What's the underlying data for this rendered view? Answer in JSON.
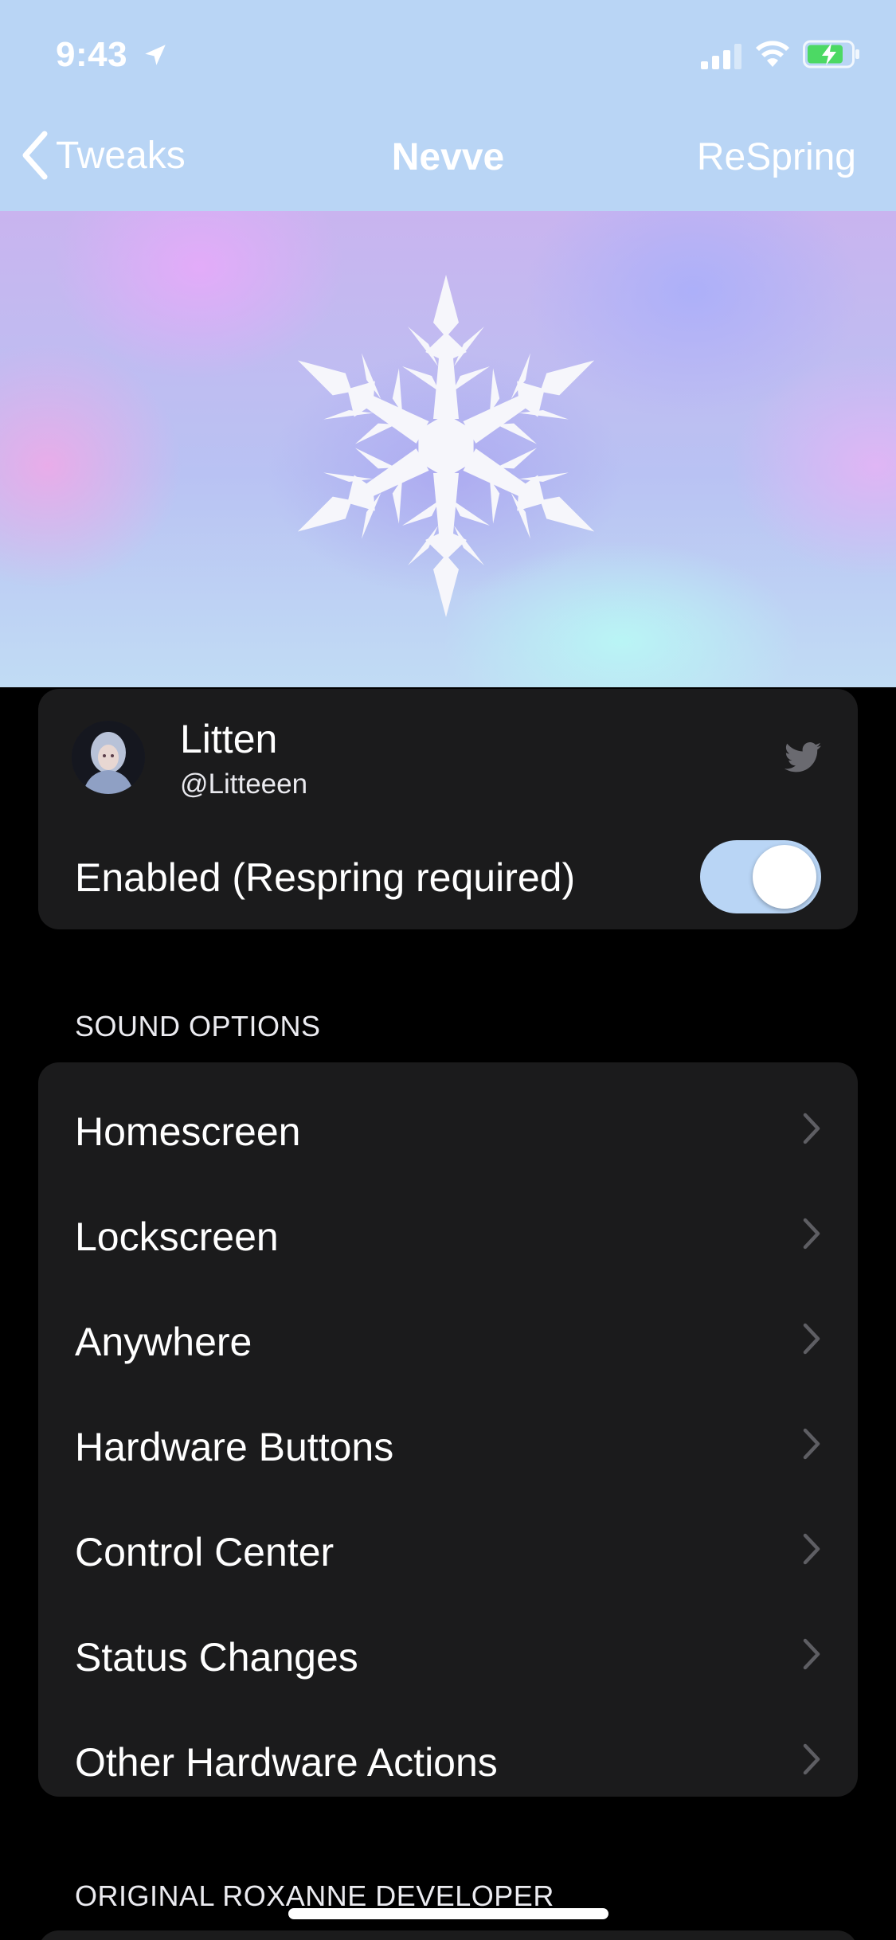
{
  "status_bar": {
    "time": "9:43",
    "icons": [
      "location-arrow-icon",
      "cellular-signal-icon",
      "wifi-icon",
      "battery-charging-icon"
    ]
  },
  "nav": {
    "back_label": "Tweaks",
    "title": "Nevve",
    "right_label": "ReSpring"
  },
  "banner": {
    "icon": "snowflake-icon"
  },
  "profile": {
    "name": "Litten",
    "handle": "@Litteeen",
    "social_icon": "twitter-icon"
  },
  "enable_row": {
    "label": "Enabled (Respring required)",
    "toggle_on": true
  },
  "sound_options": {
    "header": "SOUND OPTIONS",
    "items": [
      {
        "label": "Homescreen"
      },
      {
        "label": "Lockscreen"
      },
      {
        "label": "Anywhere"
      },
      {
        "label": "Hardware Buttons"
      },
      {
        "label": "Control Center"
      },
      {
        "label": "Status Changes"
      },
      {
        "label": "Other Hardware Actions"
      }
    ]
  },
  "developer_section": {
    "header": "ORIGINAL ROXANNE DEVELOPER"
  },
  "colors": {
    "accent": "#b9d5f5",
    "cell_background": "#1b1b1c",
    "page_background": "#000000",
    "battery_green": "#4cd964"
  }
}
